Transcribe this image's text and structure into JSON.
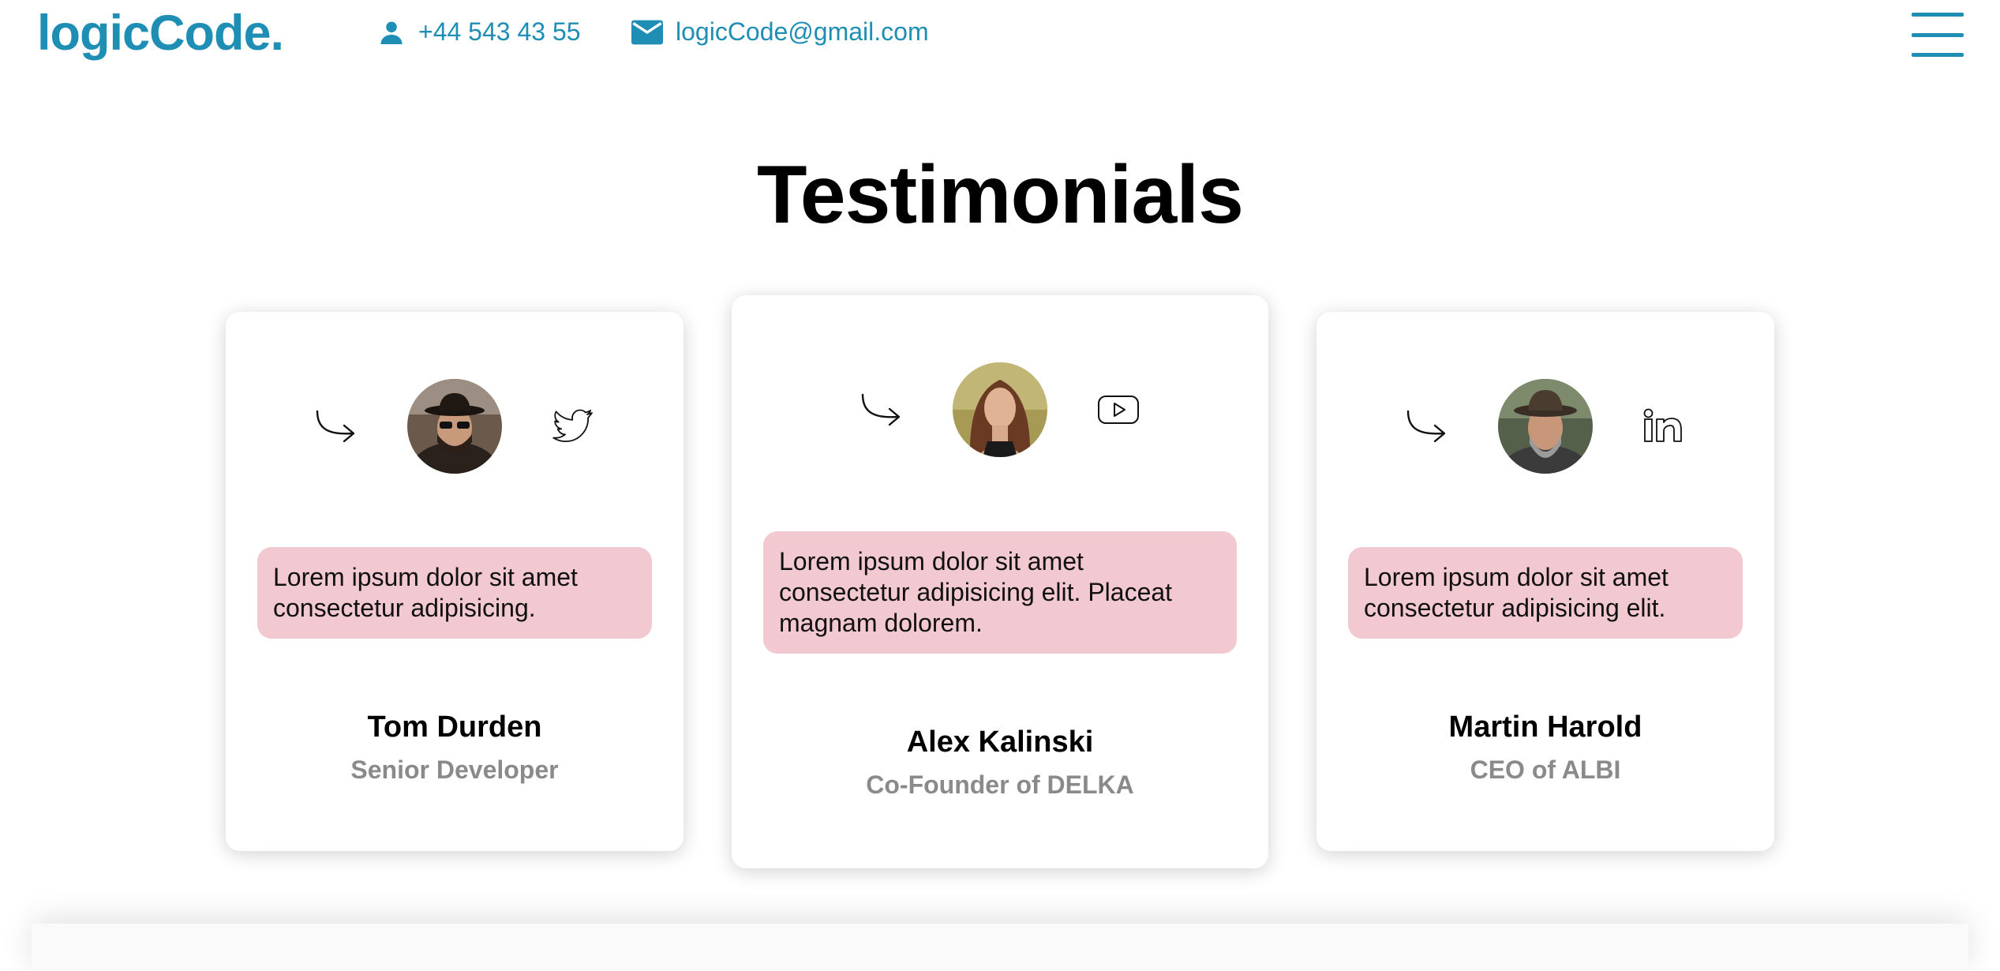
{
  "header": {
    "logo": "logicCode.",
    "phone": "+44 543 43 55",
    "email": "logicCode@gmail.com"
  },
  "section": {
    "title": "Testimonials"
  },
  "testimonials": [
    {
      "name": "Tom Durden",
      "role": "Senior Developer",
      "quote": "Lorem ipsum dolor sit amet consectetur adipisicing.",
      "social": "twitter-icon"
    },
    {
      "name": "Alex Kalinski",
      "role": "Co-Founder of DELKA",
      "quote": "Lorem ipsum dolor sit amet consectetur adipisicing elit. Placeat magnam dolorem.",
      "social": "youtube-icon"
    },
    {
      "name": "Martin Harold",
      "role": "CEO of ALBI",
      "quote": "Lorem ipsum dolor sit amet consectetur adipisicing elit.",
      "social": "linkedin-icon"
    }
  ],
  "colors": {
    "accent": "#1e8eb4",
    "quote_bg": "#f2c8d1",
    "role_text": "#8a8a8a"
  }
}
